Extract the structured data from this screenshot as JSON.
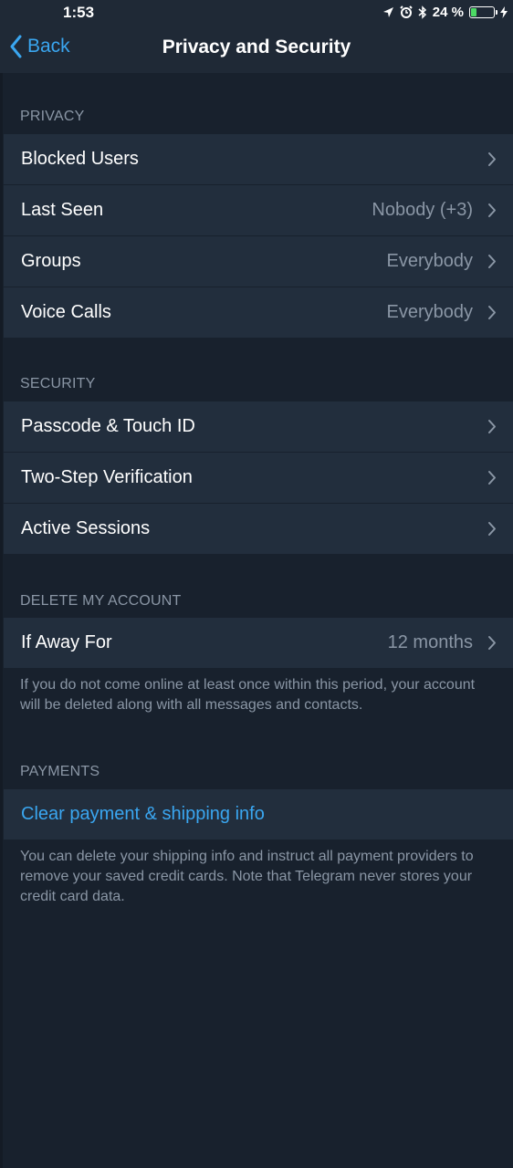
{
  "status_bar": {
    "time": "1:53",
    "battery_percent": "24 %",
    "battery_level": 0.24,
    "icons": [
      "location-arrow-icon",
      "alarm-icon",
      "bluetooth-icon",
      "battery-icon",
      "charging-bolt-icon"
    ]
  },
  "nav": {
    "back_label": "Back",
    "title": "Privacy and Security"
  },
  "colors": {
    "background": "#18212d",
    "cell": "#222e3d",
    "accent": "#3aa6f0",
    "secondary_text": "#8a96a5"
  },
  "privacy": {
    "header": "PRIVACY",
    "rows": [
      {
        "label": "Blocked Users",
        "value": ""
      },
      {
        "label": "Last Seen",
        "value": "Nobody (+3)"
      },
      {
        "label": "Groups",
        "value": "Everybody"
      },
      {
        "label": "Voice Calls",
        "value": "Everybody"
      }
    ]
  },
  "security": {
    "header": "SECURITY",
    "rows": [
      {
        "label": "Passcode & Touch ID"
      },
      {
        "label": "Two-Step Verification"
      },
      {
        "label": "Active Sessions"
      }
    ]
  },
  "delete_account": {
    "header": "DELETE MY ACCOUNT",
    "row": {
      "label": "If Away For",
      "value": "12 months"
    },
    "footnote": "If you do not come online at least once within this period, your account will be deleted along with all messages and contacts."
  },
  "payments": {
    "header": "PAYMENTS",
    "link_label": "Clear payment & shipping info",
    "footnote": "You can delete your shipping info and instruct all payment providers to remove your saved credit cards. Note that Telegram never stores your credit card data."
  }
}
